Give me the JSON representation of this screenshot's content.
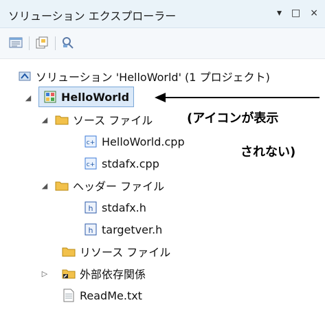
{
  "window": {
    "title": "ソリューション エクスプローラー",
    "controls": [
      "▾",
      "□",
      "×"
    ]
  },
  "toolbar": {
    "buttons": [
      {
        "icon": "properties-icon"
      },
      {
        "icon": "show-all-files-icon"
      },
      {
        "icon": "view-class-diagram-icon"
      }
    ]
  },
  "tree": {
    "solution_label": "ソリューション 'HelloWorld' (1 プロジェクト)",
    "project_label": "HelloWorld",
    "folders": {
      "source": "ソース ファイル",
      "header": "ヘッダー ファイル",
      "resource": "リソース ファイル",
      "external": "外部依存関係"
    },
    "files": {
      "source": [
        "HelloWorld.cpp",
        "stdafx.cpp"
      ],
      "header": [
        "stdafx.h",
        "targetver.h"
      ],
      "other": [
        "ReadMe.txt"
      ]
    }
  },
  "annotation": {
    "line1": "(アイコンが表示",
    "line2": "されない)"
  },
  "colors": {
    "accent": "#7aa7d8",
    "folder": "#f2c14b",
    "header_icon": "#2b5aa8",
    "cpp_icon": "#3b7ad8"
  }
}
